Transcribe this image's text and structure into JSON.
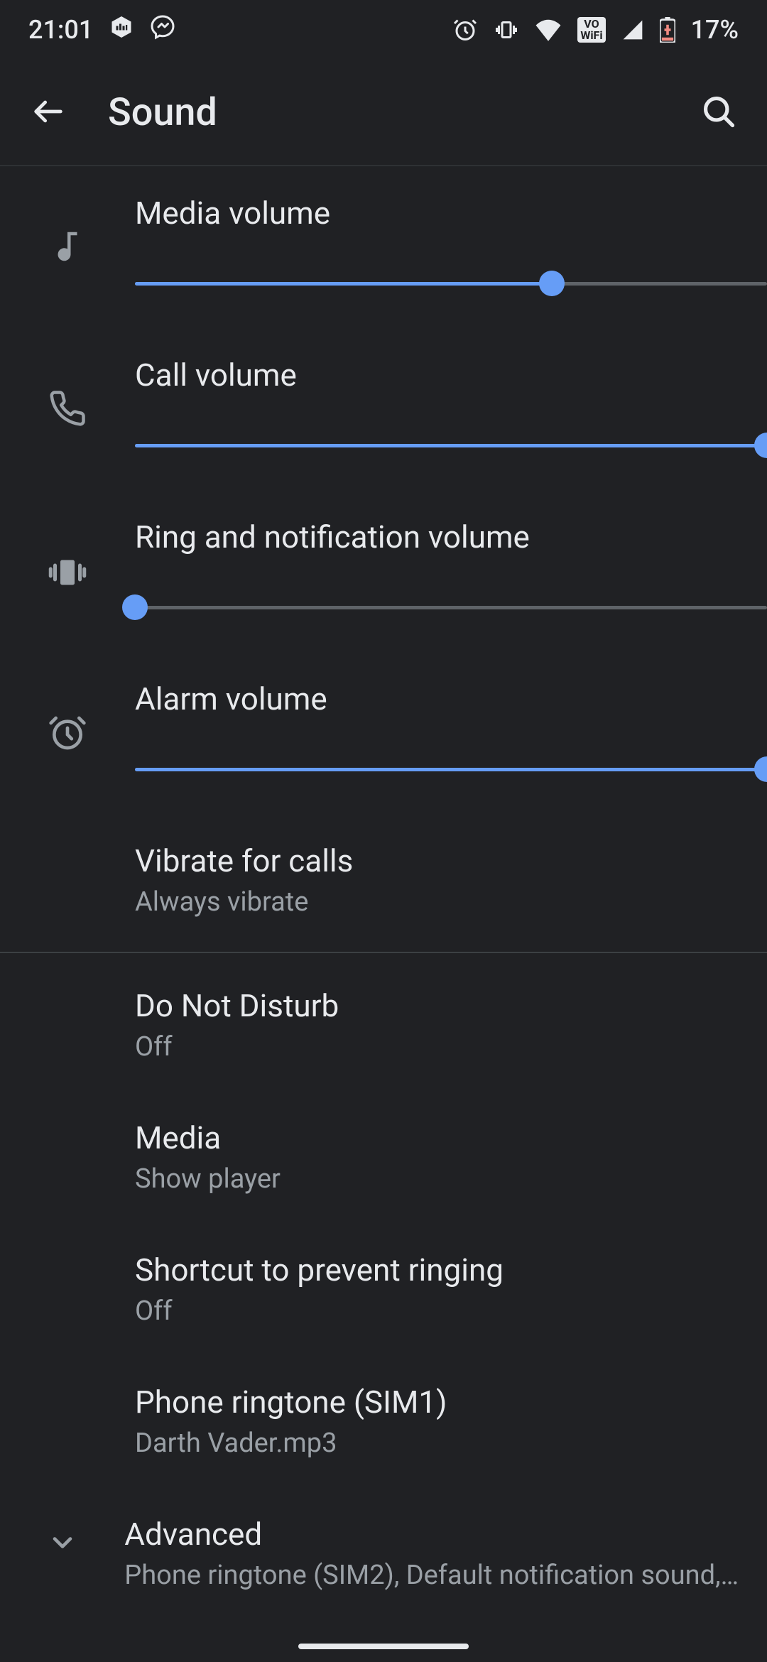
{
  "status": {
    "time": "21:01",
    "battery": "17%",
    "vowifi_top": "VO",
    "vowifi_bot": "WiFi"
  },
  "appbar": {
    "title": "Sound"
  },
  "sliders": {
    "media": {
      "label": "Media volume",
      "value": 66
    },
    "call": {
      "label": "Call volume",
      "value": 100
    },
    "ring": {
      "label": "Ring and notification volume",
      "value": 0
    },
    "alarm": {
      "label": "Alarm volume",
      "value": 100
    }
  },
  "items": {
    "vibrate": {
      "title": "Vibrate for calls",
      "subtitle": "Always vibrate"
    },
    "dnd": {
      "title": "Do Not Disturb",
      "subtitle": "Off"
    },
    "media_item": {
      "title": "Media",
      "subtitle": "Show player"
    },
    "shortcut": {
      "title": "Shortcut to prevent ringing",
      "subtitle": "Off"
    },
    "ringtone": {
      "title": "Phone ringtone (SIM1)",
      "subtitle": "Darth Vader.mp3"
    },
    "advanced": {
      "title": "Advanced",
      "subtitle": "Phone ringtone (SIM2), Default notification sound,…"
    }
  },
  "colors": {
    "accent": "#669df6",
    "background": "#202124",
    "text_primary": "#e8eaed",
    "text_secondary": "#9aa0a6"
  }
}
